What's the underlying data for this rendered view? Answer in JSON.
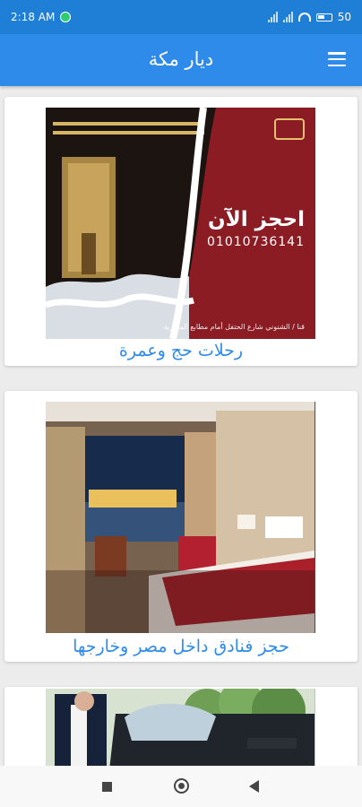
{
  "status_bar": {
    "time": "2:18 AM",
    "battery": "50"
  },
  "app_bar": {
    "title": "ديار مكة"
  },
  "cards": [
    {
      "title": "رحلات حج وعمرة",
      "image": {
        "heading": "احجز الآن",
        "phone": "01010736141",
        "address": "قنا / الشنوني شارع الحتفل أمام مطابع المصرية"
      }
    },
    {
      "title": "حجز فنادق داخل مصر وخارجها"
    },
    {
      "title": ""
    }
  ],
  "icons": {
    "menu": "hamburger-menu-icon",
    "whatsapp": "whatsapp-icon",
    "signal": "signal-icon",
    "wifi": "wifi-icon",
    "battery": "battery-icon",
    "nav_recent": "square-icon",
    "nav_home": "circle-icon",
    "nav_back": "triangle-back-icon"
  },
  "colors": {
    "status_bar": "#1f7fd6",
    "app_bar": "#2f8bea",
    "card_title": "#2f8bea",
    "poster_red": "#8b1c24"
  }
}
